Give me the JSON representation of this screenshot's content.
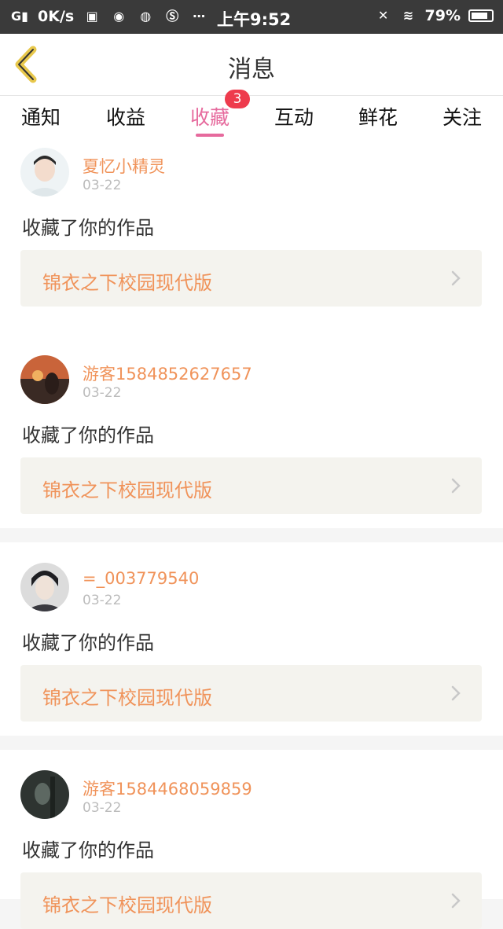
{
  "status_bar": {
    "network_speed": "0K/s",
    "time": "上午9:52",
    "battery": "79%"
  },
  "header": {
    "title": "消息"
  },
  "tabs": [
    {
      "label": "通知"
    },
    {
      "label": "收益"
    },
    {
      "label": "收藏",
      "badge": "3",
      "active": true
    },
    {
      "label": "互动"
    },
    {
      "label": "鲜花"
    },
    {
      "label": "关注"
    }
  ],
  "messages": [
    {
      "user": "夏忆小精灵",
      "date": "03-22",
      "action": "收藏了你的作品",
      "work_title": "锦衣之下校园现代版"
    },
    {
      "user": "游客1584852627657",
      "date": "03-22",
      "action": "收藏了你的作品",
      "work_title": "锦衣之下校园现代版"
    },
    {
      "user": "=_003779540",
      "date": "03-22",
      "action": "收藏了你的作品",
      "work_title": "锦衣之下校园现代版"
    },
    {
      "user": "游客1584468059859",
      "date": "03-22",
      "action": "收藏了你的作品",
      "work_title": "锦衣之下校园现代版"
    }
  ],
  "colors": {
    "accent": "#e66a9d",
    "username": "#f0935a",
    "badge": "#ee3b4d",
    "work_bg": "#f4f3ee"
  }
}
